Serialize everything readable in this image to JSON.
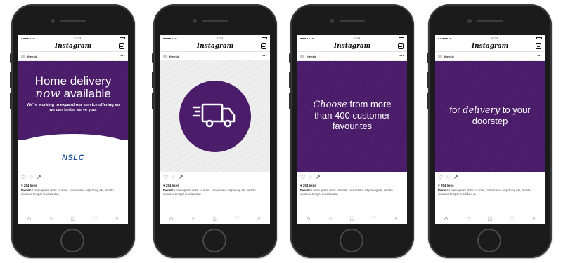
{
  "colors": {
    "brand_purple": "#4b1c6a",
    "nslc_blue": "#1e4f9c"
  },
  "phones": [
    {
      "username": "thenslc",
      "kind": "intro",
      "headline_1": "Home delivery",
      "headline_2a": "now",
      "headline_2b": " available",
      "subtext": "We're working to expand our service offering so we can better serve you.",
      "logo_text": "NSLC"
    },
    {
      "username": "thenslc",
      "kind": "truck",
      "icon": "delivery-truck-icon"
    },
    {
      "username": "thenslc",
      "kind": "choose",
      "t1": "Choose",
      "t2": " from more",
      "t3": "than 400 customer",
      "t4": "favourites"
    },
    {
      "username": "thenslc",
      "kind": "doorstep",
      "t1": "for ",
      "t2": "delivery",
      "t3": " to your",
      "t4": "doorstep"
    }
  ],
  "app": {
    "status_time": "10:33",
    "status_signal": "●●●●● ᯤ",
    "logo": "Instagram",
    "more": "•••",
    "likes": "♥ 254 likes",
    "caption_user": "thenslc",
    "caption_text": "Lorem ipsum dolor sit amet, consectetur adipiscing elit, sed do eiusmod tempor incididunt ut"
  }
}
